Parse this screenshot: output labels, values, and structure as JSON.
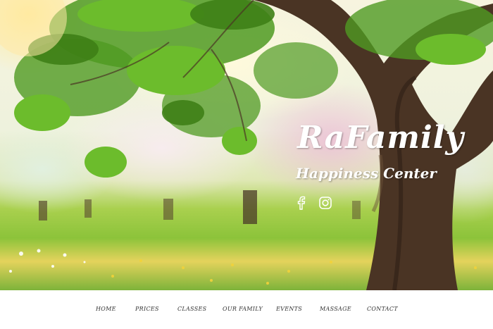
{
  "brand": {
    "title": "RaFamily",
    "subtitle": "Happiness Center"
  },
  "social": {
    "facebook_icon": "facebook-icon",
    "instagram_icon": "instagram-icon"
  },
  "nav": {
    "items": [
      {
        "label": "HOME"
      },
      {
        "label": "PRICES"
      },
      {
        "label": "CLASSES"
      },
      {
        "label": "OUR FAMILY"
      },
      {
        "label": "EVENTS"
      },
      {
        "label": "MASSAGE"
      },
      {
        "label": "CONTACT"
      }
    ]
  },
  "colors": {
    "nav_text": "#333333",
    "brand_text": "#ffffff",
    "background": "#ffffff"
  }
}
